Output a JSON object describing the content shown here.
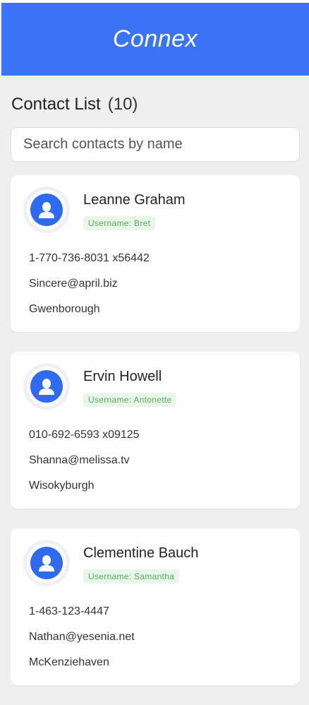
{
  "app": {
    "title": "Connex",
    "accent_color": "#3a73f5"
  },
  "list": {
    "heading": "Contact List",
    "count": "(10)"
  },
  "search": {
    "placeholder": "Search contacts by name",
    "value": ""
  },
  "contacts": [
    {
      "name": "Leanne Graham",
      "username": "Username: Bret",
      "phone": "1-770-736-8031 x56442",
      "email": "Sincere@april.biz",
      "city": "Gwenborough",
      "avatar_icon": "user-icon"
    },
    {
      "name": "Ervin Howell",
      "username": "Username: Antonette",
      "phone": "010-692-6593 x09125",
      "email": "Shanna@melissa.tv",
      "city": "Wisokyburgh",
      "avatar_icon": "user-icon"
    },
    {
      "name": "Clementine Bauch",
      "username": "Username: Samantha",
      "phone": "1-463-123-4447",
      "email": "Nathan@yesenia.net",
      "city": "McKenziehaven",
      "avatar_icon": "user-icon"
    }
  ]
}
